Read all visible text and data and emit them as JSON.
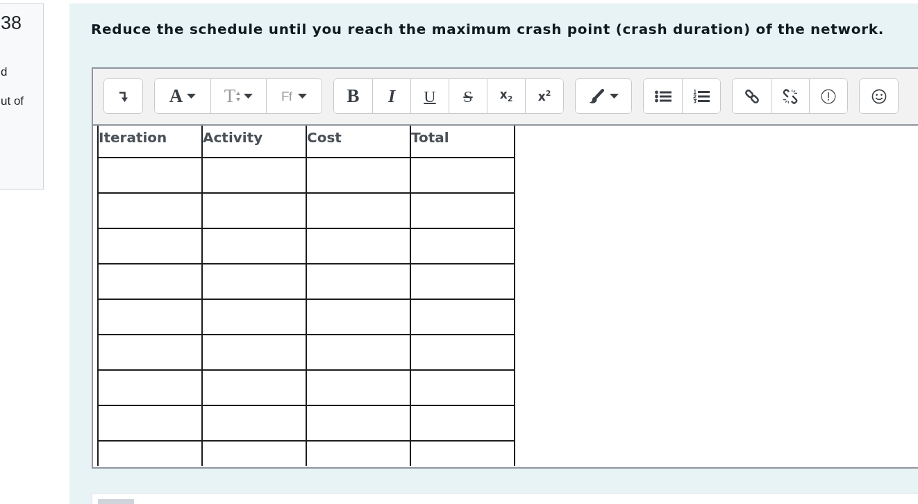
{
  "question_info": {
    "number": "38",
    "state": "d",
    "grade": "ut of"
  },
  "question": {
    "text": "Reduce the schedule until you reach the maximum crash point (crash duration) of the network."
  },
  "editor": {
    "toolbar": [
      {
        "buttons": [
          {
            "kind": "icon"
          }
        ]
      },
      {
        "buttons": [
          {
            "kind": "serifmenu",
            "label": "A"
          },
          {
            "kind": "sizemenu",
            "label": "T"
          },
          {
            "kind": "sansmenu",
            "label": "Ff"
          }
        ]
      },
      {
        "buttons": [
          {
            "kind": "bold",
            "label": "B"
          },
          {
            "kind": "italic",
            "label": "I"
          },
          {
            "kind": "underline",
            "label": "U"
          },
          {
            "kind": "strike",
            "label": "S"
          },
          {
            "kind": "sub",
            "label": "x$_{2}$"
          },
          {
            "kind": "sup",
            "label": "x$^{2}$"
          }
        ]
      },
      {
        "buttons": [
          {
            "kind": "iconmenu"
          }
        ]
      },
      {
        "buttons": [
          {
            "kind": "icon"
          },
          {
            "kind": "icon"
          }
        ]
      },
      {
        "buttons": [
          {
            "kind": "icon"
          },
          {
            "kind": "icon"
          },
          {
            "kind": "icon"
          }
        ]
      },
      {
        "buttons": [
          {
            "kind": "icon"
          }
        ]
      }
    ],
    "table": {
      "columns": [
        "Iteration",
        "Activity",
        "Cost",
        "Total"
      ],
      "rows": [
        {
          "kind": "blank"
        },
        {
          "kind": "blank"
        },
        {
          "kind": "blank"
        },
        {
          "kind": "blank"
        },
        {
          "kind": "blank"
        },
        {
          "kind": "blank"
        },
        {
          "kind": "blank"
        },
        {
          "kind": "blank"
        },
        {
          "kind": "blank"
        }
      ]
    }
  }
}
